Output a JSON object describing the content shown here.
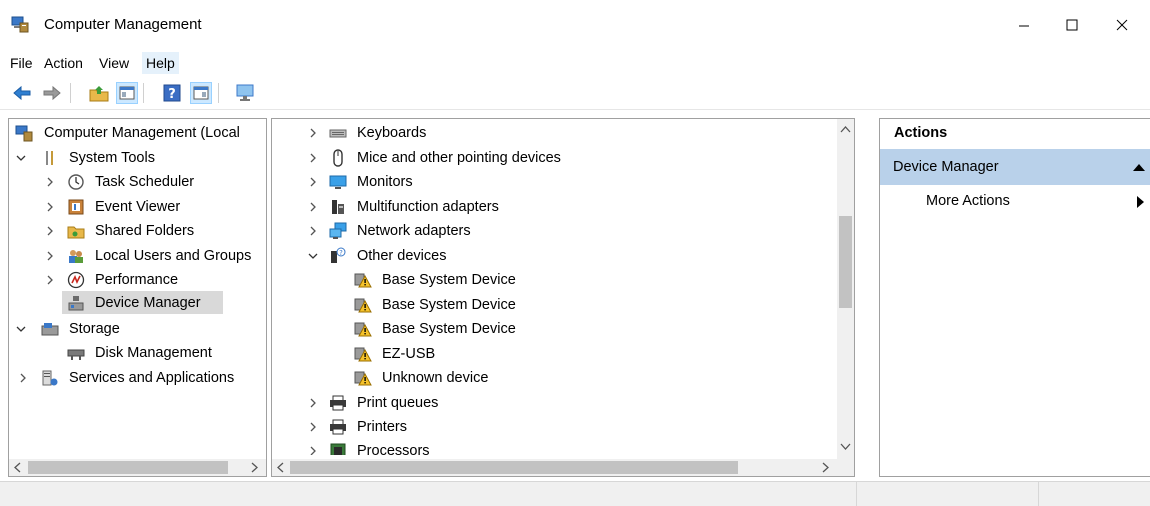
{
  "window": {
    "title": "Computer Management",
    "icon": "computer-management-icon"
  },
  "menu": [
    {
      "label": "File"
    },
    {
      "label": "Action"
    },
    {
      "label": "View"
    },
    {
      "label": "Help"
    }
  ],
  "toolbar": {
    "buttons": [
      "back-arrow-icon",
      "forward-arrow-icon",
      "up-folder-icon",
      "show-hide-tree-icon",
      "help-icon",
      "show-hide-action-pane-icon",
      "monitor-icon"
    ]
  },
  "tree": {
    "root": "Computer Management (Local",
    "items": [
      {
        "label": "System Tools",
        "icon": "system-tools-icon"
      },
      {
        "label": "Task Scheduler",
        "icon": "clock-icon"
      },
      {
        "label": "Event Viewer",
        "icon": "event-viewer-icon"
      },
      {
        "label": "Shared Folders",
        "icon": "shared-folder-icon"
      },
      {
        "label": "Local Users and Groups",
        "icon": "users-icon"
      },
      {
        "label": "Performance",
        "icon": "performance-icon"
      },
      {
        "label": "Device Manager",
        "icon": "device-manager-icon"
      },
      {
        "label": "Storage",
        "icon": "storage-icon"
      },
      {
        "label": "Disk Management",
        "icon": "disk-icon"
      },
      {
        "label": "Services and Applications",
        "icon": "services-icon"
      }
    ]
  },
  "devices": {
    "items": [
      {
        "label": "Keyboards",
        "icon": "keyboard-icon"
      },
      {
        "label": "Mice and other pointing devices",
        "icon": "mouse-icon"
      },
      {
        "label": "Monitors",
        "icon": "monitor-icon"
      },
      {
        "label": "Multifunction adapters",
        "icon": "multifunction-icon"
      },
      {
        "label": "Network adapters",
        "icon": "network-icon"
      },
      {
        "label": "Other devices",
        "icon": "unknown-device-icon"
      },
      {
        "label": "Base System Device",
        "icon": "warning-device-icon"
      },
      {
        "label": "Base System Device",
        "icon": "warning-device-icon"
      },
      {
        "label": "Base System Device",
        "icon": "warning-device-icon"
      },
      {
        "label": "EZ-USB",
        "icon": "warning-device-icon"
      },
      {
        "label": "Unknown device",
        "icon": "warning-device-icon"
      },
      {
        "label": "Print queues",
        "icon": "printer-icon"
      },
      {
        "label": "Printers",
        "icon": "printer-icon"
      },
      {
        "label": "Processors",
        "icon": "processor-icon"
      }
    ]
  },
  "actions": {
    "header": "Actions",
    "section": "Device Manager",
    "more": "More Actions"
  },
  "colors": {
    "selection": "#d9d9d9",
    "actions_section_bg": "#b9d1ea",
    "menu_hover": "#e5f1fb"
  }
}
